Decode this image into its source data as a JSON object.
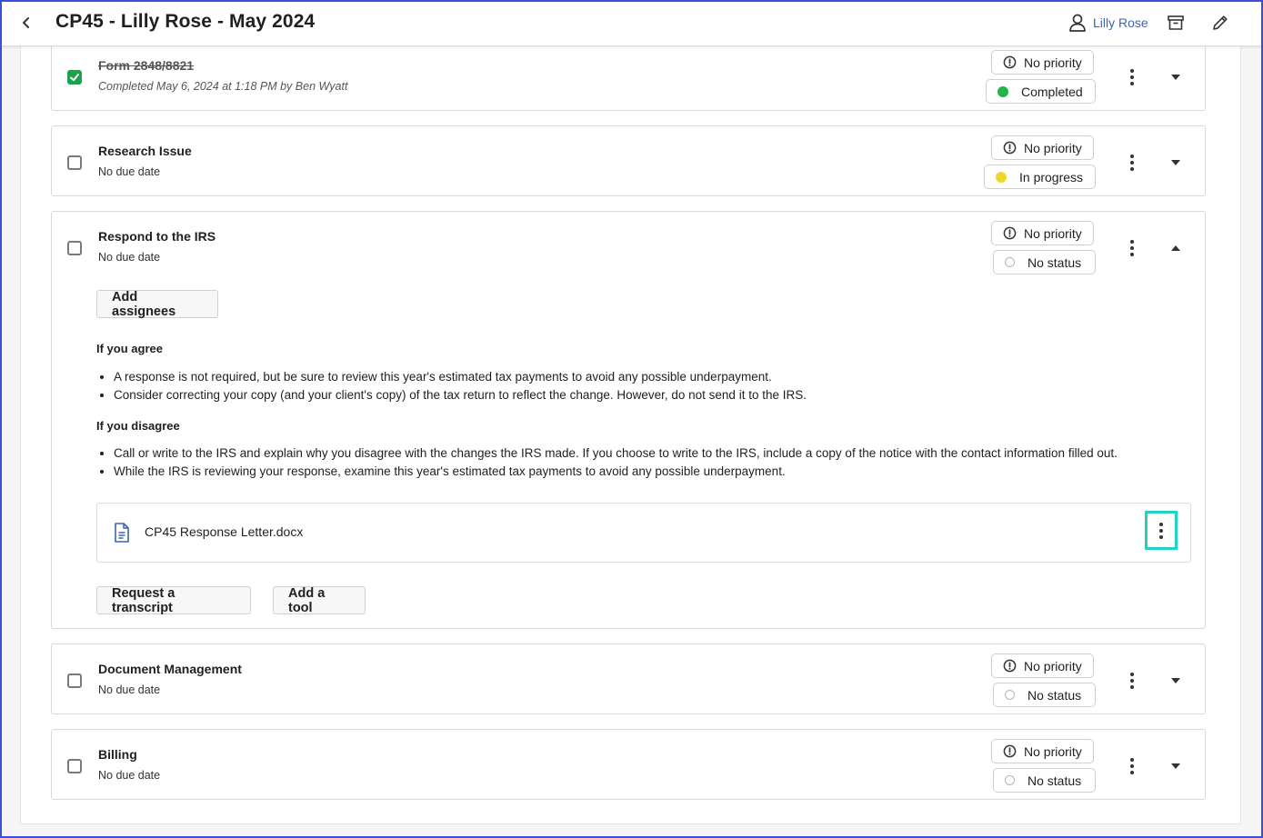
{
  "header": {
    "title": "CP45 - Lilly Rose - May 2024",
    "user_name": "Lilly Rose"
  },
  "tasks": [
    {
      "title": "Form 2848/8821",
      "subtitle": "Completed May 6, 2024 at 1:18 PM by Ben Wyatt",
      "checked": true,
      "priority": "No priority",
      "status": "Completed",
      "status_color": "#22b34b",
      "expanded": false
    },
    {
      "title": "Research Issue",
      "subtitle": "No due date",
      "checked": false,
      "priority": "No priority",
      "status": "In progress",
      "status_color": "#eed82a",
      "expanded": false
    },
    {
      "title": "Respond to the IRS",
      "subtitle": "No due date",
      "checked": false,
      "priority": "No priority",
      "status": "No status",
      "expanded": true,
      "add_assignees_label": "Add assignees",
      "sections": [
        {
          "heading": "If you agree",
          "bullets": [
            "A response is not required, but be sure to review this year's estimated tax payments to avoid any possible underpayment.",
            "Consider correcting your copy (and your client's copy) of the tax return to reflect the change. However, do not send it to the IRS."
          ]
        },
        {
          "heading": "If you disagree",
          "bullets": [
            "Call or write to the IRS and explain why you disagree with the changes the IRS made. If you choose to write to the IRS, include a copy of the notice with the contact information filled out.",
            "While the IRS is reviewing your response, examine this year's estimated tax payments to avoid any possible underpayment."
          ]
        }
      ],
      "attachment": {
        "file_name": "CP45 Response Letter.docx",
        "icon": "document-icon"
      },
      "request_transcript_label": "Request a transcript",
      "add_tool_label": "Add a tool"
    },
    {
      "title": "Document Management",
      "subtitle": "No due date",
      "checked": false,
      "priority": "No priority",
      "status": "No status",
      "expanded": false
    },
    {
      "title": "Billing",
      "subtitle": "No due date",
      "checked": false,
      "priority": "No priority",
      "status": "No status",
      "expanded": false
    }
  ],
  "colors": {
    "accent_link": "#3a63b8",
    "highlight": "#22d3c5",
    "checked_green": "#1aa34a"
  }
}
